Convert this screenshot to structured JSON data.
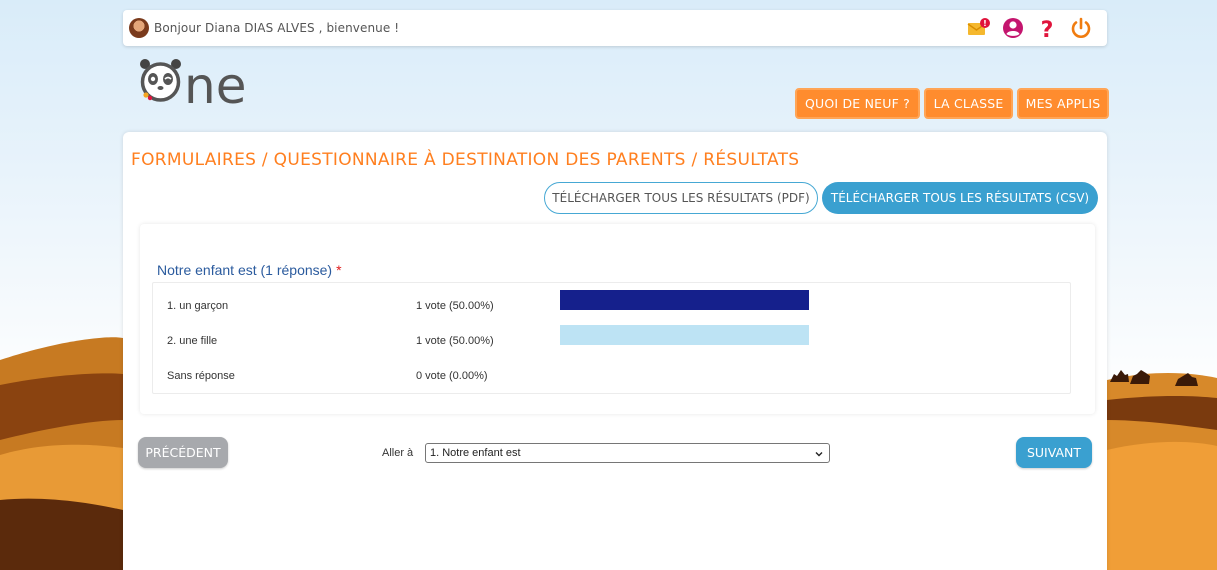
{
  "header": {
    "greeting": "Bonjour Diana DIAS ALVES , bienvenue !",
    "icons": [
      "mail-notification-icon",
      "user-profile-icon",
      "help-icon",
      "power-icon"
    ],
    "mail_badge": "!"
  },
  "logo": {
    "text": "ne",
    "name": "one-logo"
  },
  "nav": {
    "items": [
      {
        "label": "QUOI DE NEUF ?"
      },
      {
        "label": "LA CLASSE"
      },
      {
        "label": "MES APPLIS"
      }
    ]
  },
  "page": {
    "title": "FORMULAIRES / QUESTIONNAIRE À DESTINATION DES PARENTS / RÉSULTATS",
    "download_pdf": "TÉLÉCHARGER TOUS LES RÉSULTATS (PDF)",
    "download_csv": "TÉLÉCHARGER TOUS LES RÉSULTATS (CSV)"
  },
  "question": {
    "title": "Notre enfant est (1 réponse)",
    "required_marker": "*",
    "rows": [
      {
        "label": "1. un garçon",
        "votes": "1 vote (50.00%)",
        "fraction": 0.5,
        "color": "#15208c"
      },
      {
        "label": "2. une fille",
        "votes": "1 vote (50.00%)",
        "fraction": 0.5,
        "color": "#bde3f4"
      },
      {
        "label": "Sans réponse",
        "votes": "0 vote (0.00%)",
        "fraction": 0.0,
        "color": "#15208c"
      }
    ]
  },
  "footer": {
    "prev_label": "PRÉCÉDENT",
    "goto_label": "Aller à",
    "goto_selected": "1. Notre enfant est",
    "next_label": "SUIVANT"
  },
  "colors": {
    "accent_orange": "#ff8c2e",
    "accent_blue": "#3aa0d0",
    "title_blue": "#2b5b9e"
  }
}
